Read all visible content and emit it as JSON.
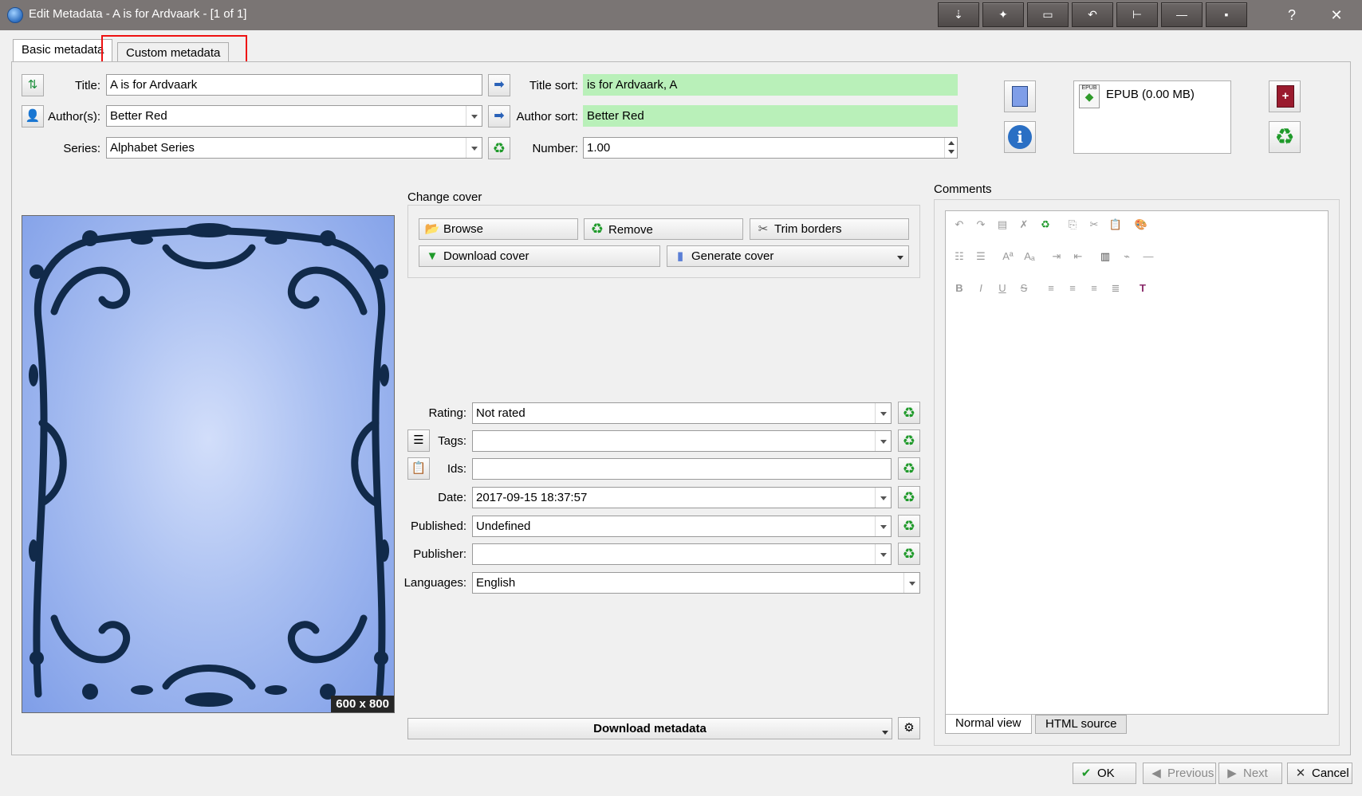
{
  "window": {
    "title": "Edit Metadata - A is for Ardvaark -  [1 of 1]",
    "help": "?",
    "close": "✕"
  },
  "tabs": [
    {
      "label": "Basic metadata",
      "active": true
    },
    {
      "label": "Custom metadata",
      "active": false
    }
  ],
  "fields": {
    "title": {
      "label": "Title:",
      "value": "A is for Ardvaark"
    },
    "authors": {
      "label": "Author(s):",
      "value": "Better Red"
    },
    "series": {
      "label": "Series:",
      "value": "Alphabet Series"
    },
    "title_sort": {
      "label": "Title sort:",
      "value": "is for Ardvaark, A"
    },
    "author_sort": {
      "label": "Author sort:",
      "value": "Better Red"
    },
    "number": {
      "label": "Number:",
      "value": "1.00"
    }
  },
  "formats": {
    "items": [
      {
        "label": "EPUB (0.00 MB)",
        "badge": "EPUB"
      }
    ]
  },
  "cover": {
    "size_label": "600 x 800",
    "group_title": "Change cover",
    "browse": "Browse",
    "remove": "Remove",
    "trim": "Trim borders",
    "download": "Download cover",
    "generate": "Generate cover"
  },
  "details": {
    "rating": {
      "label": "Rating:",
      "value": "Not rated"
    },
    "tags": {
      "label": "Tags:",
      "value": ""
    },
    "ids": {
      "label": "Ids:",
      "value": ""
    },
    "date": {
      "label": "Date:",
      "value": "2017-09-15 18:37:57"
    },
    "published": {
      "label": "Published:",
      "value": "Undefined"
    },
    "publisher": {
      "label": "Publisher:",
      "value": ""
    },
    "languages": {
      "label": "Languages:",
      "value": "English"
    }
  },
  "download_metadata": "Download metadata",
  "comments": {
    "title": "Comments",
    "view_tabs": [
      "Normal view",
      "HTML source"
    ]
  },
  "footer": {
    "ok": "OK",
    "previous": "Previous",
    "next": "Next",
    "cancel": "Cancel"
  },
  "colors": {
    "titlebar": "#7a7574",
    "sort_field_bg": "#b9f0b9",
    "recycle_icon": "#1f9a2a",
    "highlight_box": "#ee1111"
  }
}
